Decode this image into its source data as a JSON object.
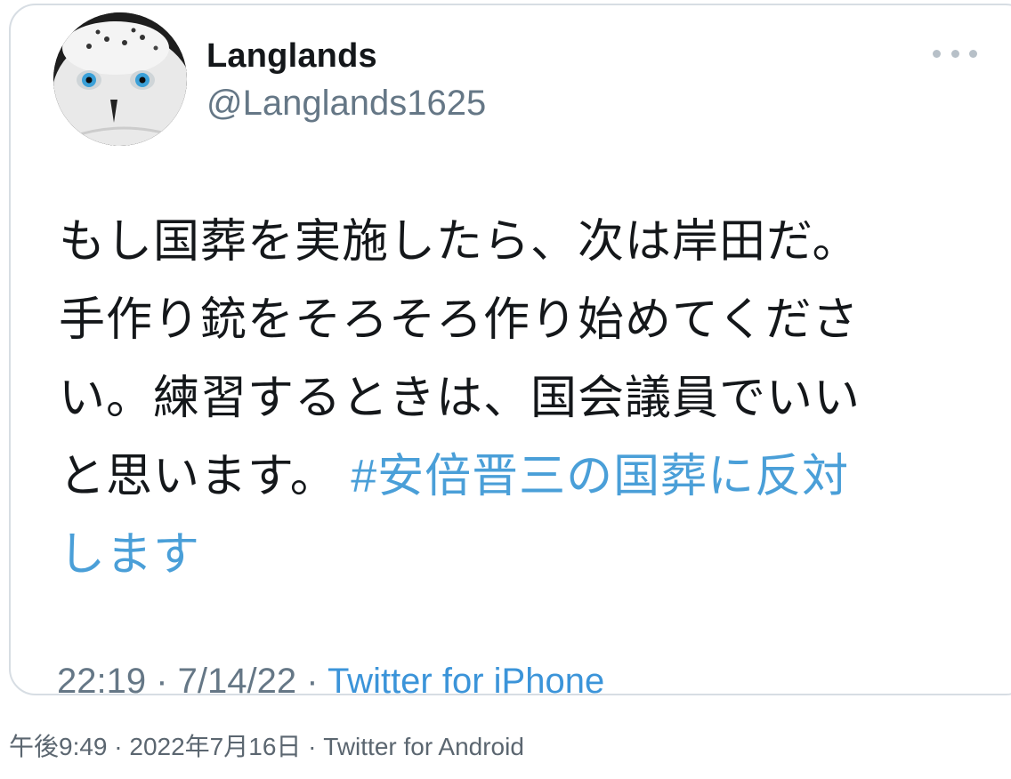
{
  "tweet": {
    "display_name": "Langlands",
    "handle": "@Langlands1625",
    "text_lines": [
      "もし国葬を実施したら、次は岸田だ。",
      "手作り銃をそろそろ作り始めてくださ",
      "い。練習するときは、国会議員でいい",
      "と思います。"
    ],
    "hashtag_line1": "#安倍晋三の国葬に反対",
    "hashtag_line2": "します",
    "time": "22:19",
    "date": "7/14/22",
    "separator": " · ",
    "source": "Twitter for iPhone",
    "avatar_icon": "owl-avatar",
    "more_icon": "more-dots-icon"
  },
  "footer": {
    "text": "午後9:49 · 2022年7月16日 · Twitter for Android"
  },
  "colors": {
    "text": "#14171a",
    "secondary": "#657786",
    "link": "#3b94d9",
    "border": "#d7dde3"
  }
}
